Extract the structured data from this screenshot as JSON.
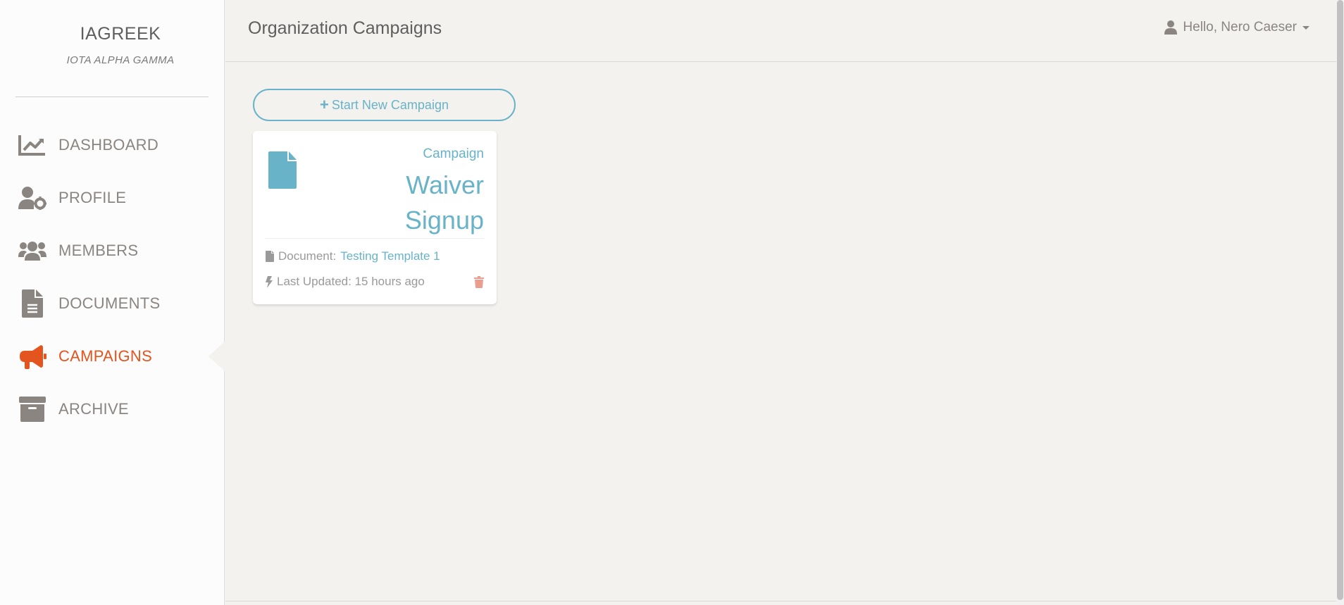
{
  "brand": {
    "title": "IAGREEK",
    "subtitle": "IOTA ALPHA GAMMA"
  },
  "sidebar": {
    "items": [
      {
        "label": "DASHBOARD",
        "icon": "chart-line-icon",
        "active": false
      },
      {
        "label": "PROFILE",
        "icon": "user-gear-icon",
        "active": false
      },
      {
        "label": "MEMBERS",
        "icon": "users-icon",
        "active": false
      },
      {
        "label": "DOCUMENTS",
        "icon": "document-icon",
        "active": false
      },
      {
        "label": "CAMPAIGNS",
        "icon": "megaphone-icon",
        "active": true
      },
      {
        "label": "ARCHIVE",
        "icon": "archive-box-icon",
        "active": false
      }
    ]
  },
  "header": {
    "title": "Organization Campaigns",
    "user_greeting": "Hello, Nero Caeser"
  },
  "main": {
    "start_button_label": "Start New Campaign",
    "campaigns": [
      {
        "kicker": "Campaign",
        "title": "Waiver Signup",
        "document_label": "Document:",
        "document_name": "Testing Template 1",
        "updated_label": "Last Updated: 15 hours ago"
      }
    ]
  },
  "colors": {
    "accent": "#68b3c8",
    "active": "#e4541e",
    "danger": "#eb9e8e",
    "sidebar_bg": "#fcfcfc",
    "page_bg": "#f3f2ef"
  }
}
